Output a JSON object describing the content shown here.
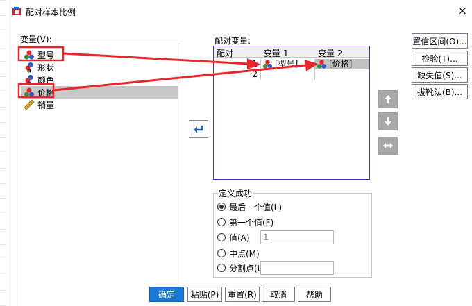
{
  "window": {
    "title": "配对样本比例",
    "close_label": "×"
  },
  "variables": {
    "label": "变量(V):",
    "label_u": "V",
    "items": [
      {
        "label": "型号",
        "icon": "nominal-variable-icon"
      },
      {
        "label": "形状",
        "icon": "nominal-text-variable-icon"
      },
      {
        "label": "颜色",
        "icon": "nominal-text-variable-icon"
      },
      {
        "label": "价格",
        "icon": "nominal-variable-icon",
        "selected": true
      },
      {
        "label": "销量",
        "icon": "scale-ruler-icon"
      }
    ]
  },
  "paired": {
    "label": "配对变量:",
    "headers": [
      "配对",
      "变量 1",
      "变量 2"
    ],
    "rows": [
      {
        "num": "1",
        "var1": "[型号]",
        "var2": "[价格]"
      },
      {
        "num": "2",
        "var1": "",
        "var2": ""
      }
    ]
  },
  "right_buttons": {
    "confidence": "置信区间(O)...",
    "test": "检验(T)...",
    "missing": "缺失值(S)...",
    "bootstrap": "拔靴法(B)..."
  },
  "success": {
    "title": "定义成功",
    "options": [
      {
        "label": "最后一个值(L)",
        "checked": true
      },
      {
        "label": "第一个值(F)"
      },
      {
        "label": "值(A)",
        "input": "1"
      },
      {
        "label": "中点(M)"
      },
      {
        "label": "分割点(U)",
        "input": ""
      }
    ]
  },
  "bottom_buttons": {
    "ok": "确定",
    "paste": "粘贴(P)",
    "reset": "重置(R)",
    "cancel": "取消",
    "help": "帮助"
  },
  "colors": {
    "primary": "#1a78d8",
    "annotation": "#e8262c",
    "list_border": "#3c3cb4"
  }
}
